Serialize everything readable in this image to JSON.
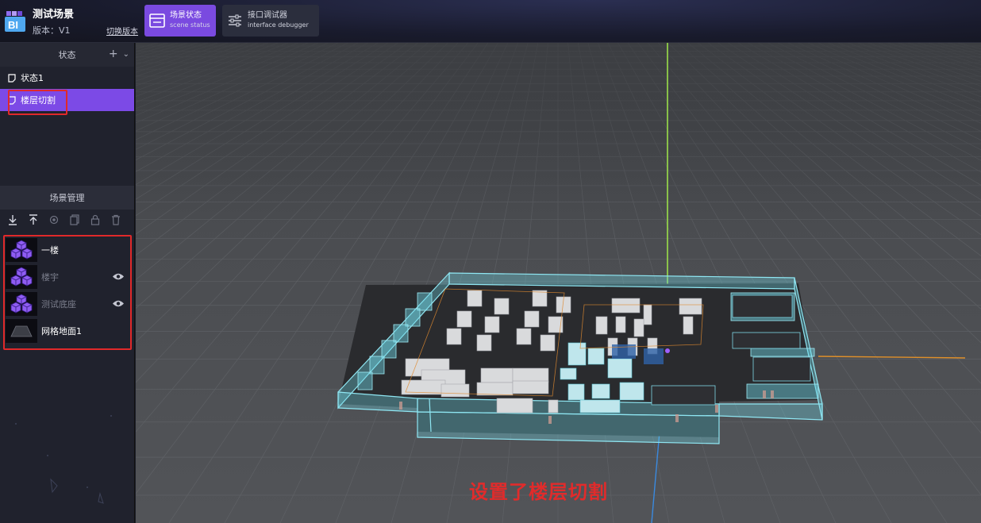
{
  "header": {
    "app_title": "测试场景",
    "version": "版本：V1",
    "switch_version": "切换版本",
    "logo_text": "BI",
    "tabs": [
      {
        "label": "场景状态",
        "sub": "scene status"
      },
      {
        "label": "接口调试器",
        "sub": "interface debugger"
      }
    ]
  },
  "states_panel": {
    "title": "状态",
    "add_icon": "plus-icon",
    "collapse_icon": "chevron-down-icon",
    "items": [
      {
        "label": "状态1"
      },
      {
        "label": "楼层切割"
      }
    ]
  },
  "scene_panel": {
    "title": "场景管理",
    "toolbar_icons": [
      "download-icon",
      "upload-icon",
      "target-icon",
      "copy-icon",
      "lock-icon",
      "trash-icon"
    ],
    "layers": [
      {
        "label": "一楼",
        "visible_toggle": false
      },
      {
        "label": "楼宇",
        "visible_toggle": true
      },
      {
        "label": "测试底座",
        "visible_toggle": true
      },
      {
        "label": "网格地面1",
        "visible_toggle": false
      }
    ]
  },
  "viewport": {
    "caption": "设置了楼层切割"
  },
  "colors": {
    "accent": "#7c4ae6",
    "highlight": "#e0292a",
    "glass": "#6fd6e6"
  }
}
